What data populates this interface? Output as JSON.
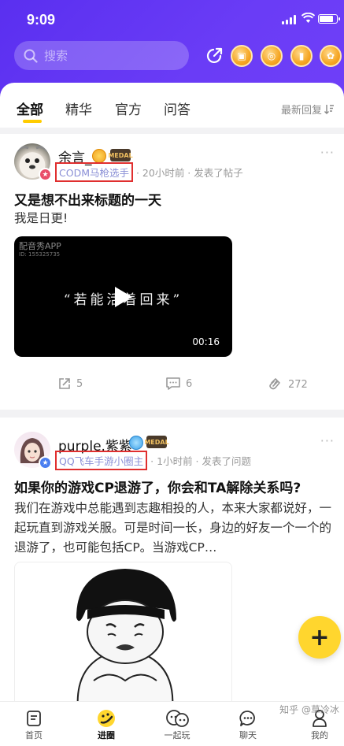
{
  "status_bar": {
    "time": "9:09",
    "battery_level": 0.85
  },
  "search": {
    "placeholder": "搜索"
  },
  "header_icons": [
    "share-icon",
    "gift-coin-icon",
    "disc-coin-icon",
    "bill-coin-icon",
    "candy-coin-icon"
  ],
  "tabs": [
    {
      "label": "全部",
      "active": true
    },
    {
      "label": "精华",
      "active": false
    },
    {
      "label": "官方",
      "active": false
    },
    {
      "label": "问答",
      "active": false
    }
  ],
  "sort": {
    "label": "最新回复"
  },
  "posts": [
    {
      "username": "余言_",
      "tag": "CODM马枪选手",
      "time": "· 20小时前 · 发表了帖子",
      "title": "又是想不出来标题的一天",
      "body": "我是日更!",
      "video": {
        "watermark": "配音秀APP",
        "watermark_id": "ID: 155325735",
        "caption": "“若能活着回来”",
        "duration": "00:16"
      },
      "actions": {
        "shares": "5",
        "comments": "6",
        "likes": "272"
      }
    },
    {
      "username": "purple.紫紫",
      "tag": "QQ飞车手游小圈主",
      "time": "· 1小时前 · 发表了问题",
      "title": "如果你的游戏CP退游了，你会和TA解除关系吗?",
      "body": "我们在游戏中总能遇到志趣相投的人，本来大家都说好，一起玩直到游戏关服。可是时间一长，身边的好友一个一个的退游了，也可能包括CP。当游戏CP…"
    }
  ],
  "fab": {
    "label": "+"
  },
  "bottom_nav": [
    {
      "label": "首页",
      "icon": "home-icon",
      "active": false
    },
    {
      "label": "进圈",
      "icon": "circle-icon",
      "active": true
    },
    {
      "label": "一起玩",
      "icon": "play-together-icon",
      "active": false
    },
    {
      "label": "聊天",
      "icon": "chat-icon",
      "active": false
    },
    {
      "label": "我的",
      "icon": "profile-icon",
      "active": false
    }
  ],
  "watermark": "知乎 @草冷冰"
}
